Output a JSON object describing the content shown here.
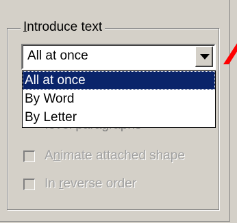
{
  "group": {
    "title_accel": "I",
    "title_rest": "ntroduce text"
  },
  "combo": {
    "value": "All at once"
  },
  "dropdown": {
    "items": [
      "All at once",
      "By Word",
      "By Letter"
    ]
  },
  "partial_option": {
    "text": "level paragraphs"
  },
  "options": {
    "animate_shape": {
      "pre": "A",
      "accel": "n",
      "post": "imate attached shape",
      "checked": false
    },
    "reverse_order": {
      "pre": "In ",
      "accel": "r",
      "post": "everse order",
      "checked": false
    }
  },
  "colors": {
    "face": "#d4d0c8",
    "highlight": "#0a246a",
    "callout": "#ff0000"
  }
}
